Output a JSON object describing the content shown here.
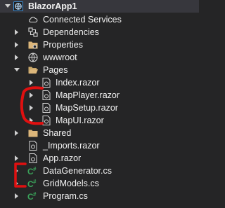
{
  "solution_explorer": {
    "project": {
      "name": "BlazorApp1",
      "expanded": true
    },
    "nodes": [
      {
        "label": "Connected Services",
        "icon": "connected-services-icon"
      },
      {
        "label": "Dependencies",
        "icon": "dependencies-icon",
        "expanded": false
      },
      {
        "label": "Properties",
        "icon": "properties-folder-icon",
        "expanded": false
      },
      {
        "label": "wwwroot",
        "icon": "globe-icon",
        "expanded": false
      },
      {
        "label": "Pages",
        "icon": "folder-open-icon",
        "expanded": true,
        "children": [
          {
            "label": "Index.razor",
            "icon": "razor-file-icon",
            "expanded": false
          },
          {
            "label": "MapPlayer.razor",
            "icon": "razor-file-icon",
            "expanded": false
          },
          {
            "label": "MapSetup.razor",
            "icon": "razor-file-icon",
            "expanded": false
          },
          {
            "label": "MapUI.razor",
            "icon": "razor-file-icon",
            "expanded": false
          }
        ]
      },
      {
        "label": "Shared",
        "icon": "folder-icon",
        "expanded": false
      },
      {
        "label": "_Imports.razor",
        "icon": "razor-file-icon"
      },
      {
        "label": "App.razor",
        "icon": "razor-file-icon",
        "expanded": false
      },
      {
        "label": "DataGenerator.cs",
        "icon": "csharp-file-icon",
        "expanded": false
      },
      {
        "label": "GridModels.cs",
        "icon": "csharp-file-icon",
        "expanded": false
      },
      {
        "label": "Program.cs",
        "icon": "csharp-file-icon",
        "expanded": false
      }
    ]
  },
  "colors": {
    "background": "#252526",
    "selected_row": "#37373d",
    "text": "#f1f1f1",
    "annotation": "#e01010",
    "csharp_green": "#3aa35a",
    "folder": "#dcb67a"
  }
}
